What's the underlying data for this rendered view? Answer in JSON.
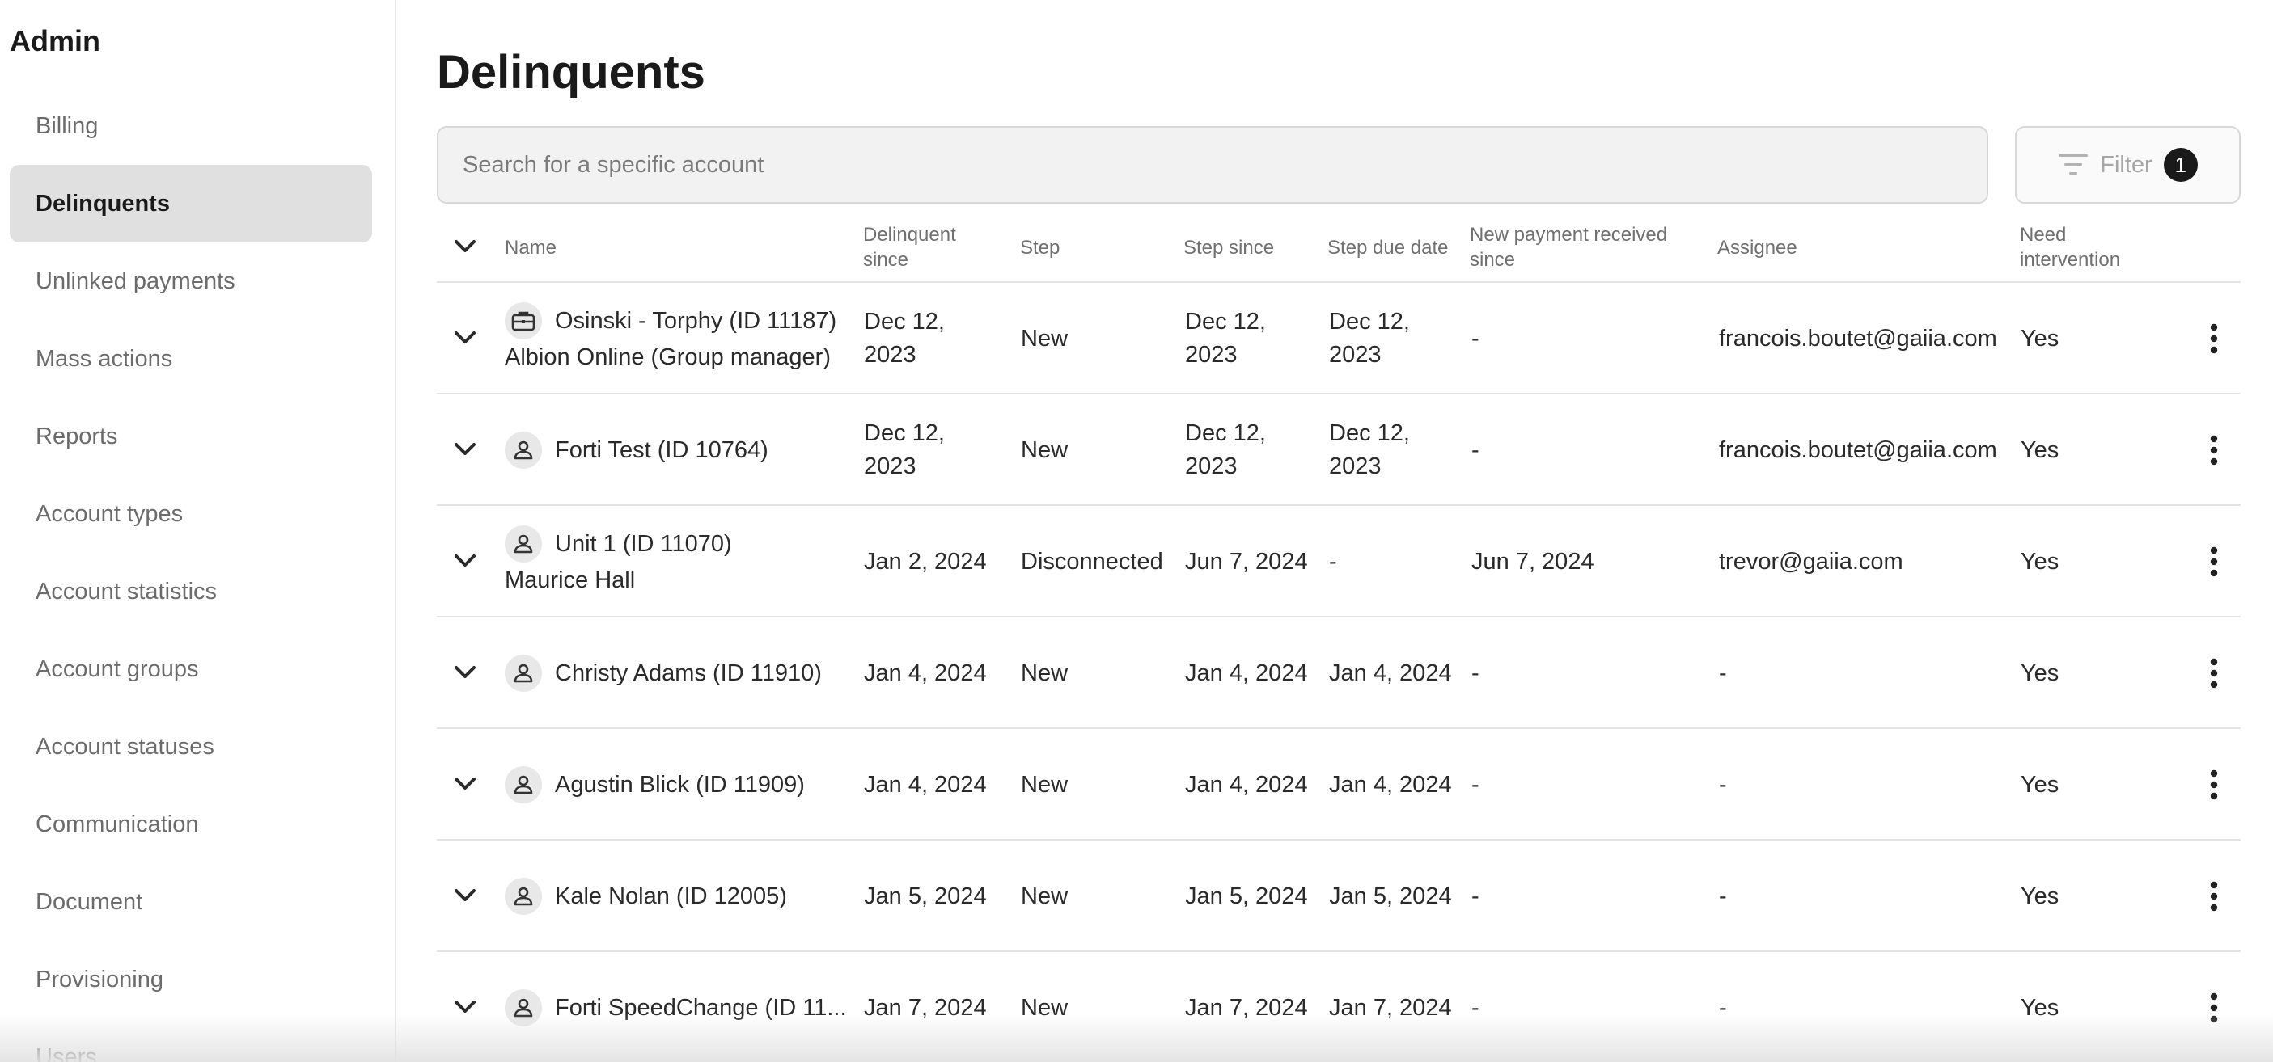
{
  "sidebar": {
    "title": "Admin",
    "items": [
      {
        "label": "Billing"
      },
      {
        "label": "Delinquents",
        "active": true
      },
      {
        "label": "Unlinked payments"
      },
      {
        "label": "Mass actions"
      },
      {
        "label": "Reports"
      },
      {
        "label": "Account types"
      },
      {
        "label": "Account statistics"
      },
      {
        "label": "Account groups"
      },
      {
        "label": "Account statuses"
      },
      {
        "label": "Communication"
      },
      {
        "label": "Document"
      },
      {
        "label": "Provisioning"
      },
      {
        "label": "Users"
      }
    ]
  },
  "main": {
    "title": "Delinquents",
    "search": {
      "placeholder": "Search for a specific account",
      "value": ""
    },
    "filter": {
      "label": "Filter",
      "count": "1"
    }
  },
  "table": {
    "columns": {
      "name": "Name",
      "delinquent_since": "Delinquent since",
      "step": "Step",
      "step_since": "Step since",
      "step_due_date": "Step due date",
      "new_payment": "New payment received since",
      "assignee": "Assignee",
      "need_intervention": "Need intervention"
    },
    "rows": [
      {
        "icon": "briefcase-icon",
        "name": "Osinski - Torphy (ID 11187)",
        "sub": "Albion Online (Group manager)",
        "delinquent_since": "Dec 12, 2023",
        "step": "New",
        "step_since": "Dec 12, 2023",
        "step_due_date": "Dec 12, 2023",
        "new_payment": "-",
        "assignee": "francois.boutet@gaiia.com",
        "need_intervention": "Yes"
      },
      {
        "icon": "person-icon",
        "name": "Forti Test (ID 10764)",
        "sub": "",
        "delinquent_since": "Dec 12, 2023",
        "step": "New",
        "step_since": "Dec 12, 2023",
        "step_due_date": "Dec 12, 2023",
        "new_payment": "-",
        "assignee": "francois.boutet@gaiia.com",
        "need_intervention": "Yes"
      },
      {
        "icon": "person-icon",
        "name": "Unit 1 (ID 11070)",
        "sub": "Maurice Hall",
        "delinquent_since": "Jan 2, 2024",
        "step": "Disconnected",
        "step_since": "Jun 7, 2024",
        "step_due_date": "-",
        "new_payment": "Jun 7, 2024",
        "assignee": "trevor@gaiia.com",
        "need_intervention": "Yes"
      },
      {
        "icon": "person-icon",
        "name": "Christy Adams (ID 11910)",
        "sub": "",
        "delinquent_since": "Jan 4, 2024",
        "step": "New",
        "step_since": "Jan 4, 2024",
        "step_due_date": "Jan 4, 2024",
        "new_payment": "-",
        "assignee": "-",
        "need_intervention": "Yes"
      },
      {
        "icon": "person-icon",
        "name": "Agustin Blick (ID 11909)",
        "sub": "",
        "delinquent_since": "Jan 4, 2024",
        "step": "New",
        "step_since": "Jan 4, 2024",
        "step_due_date": "Jan 4, 2024",
        "new_payment": "-",
        "assignee": "-",
        "need_intervention": "Yes"
      },
      {
        "icon": "person-icon",
        "name": "Kale Nolan (ID 12005)",
        "sub": "",
        "delinquent_since": "Jan 5, 2024",
        "step": "New",
        "step_since": "Jan 5, 2024",
        "step_due_date": "Jan 5, 2024",
        "new_payment": "-",
        "assignee": "-",
        "need_intervention": "Yes"
      },
      {
        "icon": "person-icon",
        "name": "Forti SpeedChange (ID 11...",
        "sub": "",
        "delinquent_since": "Jan 7, 2024",
        "step": "New",
        "step_since": "Jan 7, 2024",
        "step_due_date": "Jan 7, 2024",
        "new_payment": "-",
        "assignee": "-",
        "need_intervention": "Yes"
      }
    ]
  }
}
